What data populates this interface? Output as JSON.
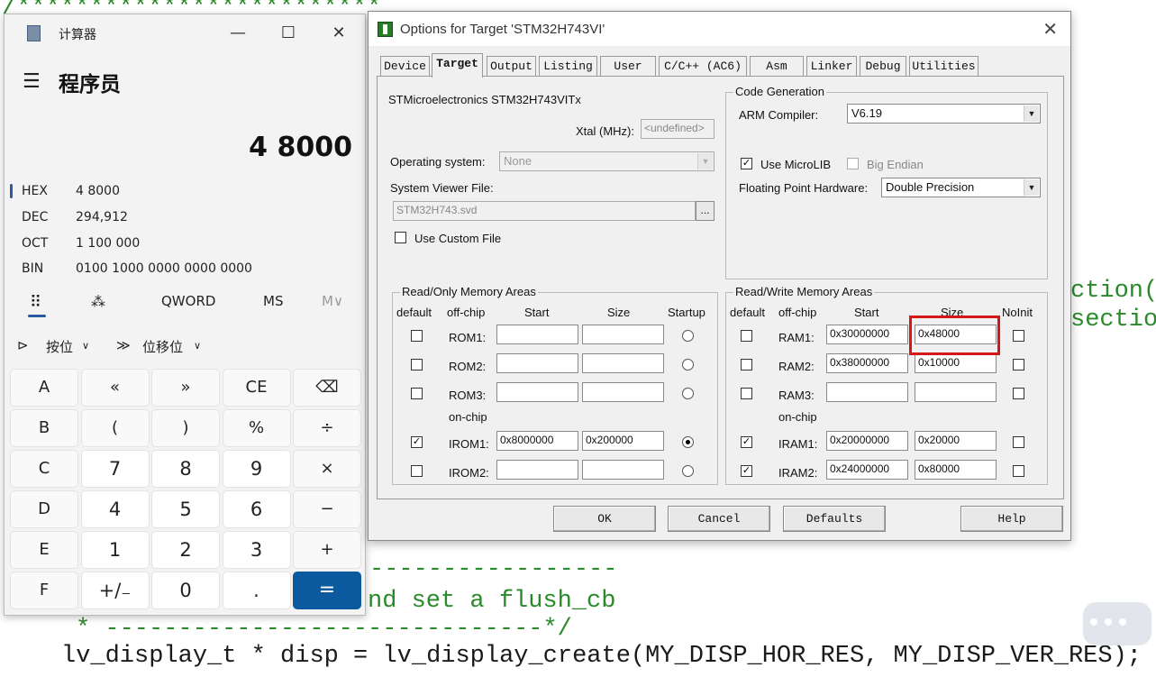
{
  "background_code": {
    "top_comment": "/*************************",
    "right_line1": "ction(",
    "right_line2": "sectio",
    "dash_line": "-----------------",
    "flush_line": "nd set a flush_cb",
    "comment_end": "* ------------------------------*/",
    "create_line": "lv_display_t * disp = lv_display_create(MY_DISP_HOR_RES, MY_DISP_VER_RES);",
    "partial_line": "  ..."
  },
  "calculator": {
    "title": "计算器",
    "mode": "程序员",
    "display": "4 8000",
    "radix": [
      {
        "label": "HEX",
        "value": "4 8000"
      },
      {
        "label": "DEC",
        "value": "294,912"
      },
      {
        "label": "OCT",
        "value": "1 100 000"
      },
      {
        "label": "BIN",
        "value": "0100 1000 0000 0000 0000"
      }
    ],
    "word_size": "QWORD",
    "ms": "MS",
    "mplus": "M∨",
    "bitwise": "按位",
    "bitshift": "位移位",
    "keys": [
      [
        "A",
        "«",
        "»",
        "CE",
        "⌫"
      ],
      [
        "B",
        "(",
        ")",
        "%",
        "÷"
      ],
      [
        "C",
        "7",
        "8",
        "9",
        "×"
      ],
      [
        "D",
        "4",
        "5",
        "6",
        "−"
      ],
      [
        "E",
        "1",
        "2",
        "3",
        "+"
      ],
      [
        "F",
        "+/₋",
        "0",
        ".",
        "="
      ]
    ]
  },
  "dialog": {
    "title": "Options for Target 'STM32H743VI'",
    "tabs": [
      "Device",
      "Target",
      "Output",
      "Listing",
      "User",
      "C/C++ (AC6)",
      "Asm",
      "Linker",
      "Debug",
      "Utilities"
    ],
    "active_tab": "Target",
    "device_name": "STMicroelectronics STM32H743VITx",
    "xtal_label": "Xtal (MHz):",
    "xtal_value": "<undefined>",
    "os_label": "Operating system:",
    "os_value": "None",
    "svf_label": "System Viewer File:",
    "svf_value": "STM32H743.svd",
    "browse": "...",
    "custom_file": "Use Custom File",
    "code_gen": {
      "legend": "Code Generation",
      "compiler_label": "ARM Compiler:",
      "compiler_value": "V6.19",
      "microlib": "Use MicroLIB",
      "microlib_checked": true,
      "big_endian": "Big Endian",
      "fpu_label": "Floating Point Hardware:",
      "fpu_value": "Double Precision"
    },
    "ro_group": {
      "legend": "Read/Only Memory Areas",
      "headers": [
        "default",
        "off-chip",
        "Start",
        "Size",
        "Startup"
      ],
      "on_chip": "on-chip",
      "rows": [
        {
          "name": "ROM1:",
          "default": false,
          "start": "",
          "size": "",
          "startup": false
        },
        {
          "name": "ROM2:",
          "default": false,
          "start": "",
          "size": "",
          "startup": false
        },
        {
          "name": "ROM3:",
          "default": false,
          "start": "",
          "size": "",
          "startup": false
        },
        {
          "name": "IROM1:",
          "default": true,
          "start": "0x8000000",
          "size": "0x200000",
          "startup": true
        },
        {
          "name": "IROM2:",
          "default": false,
          "start": "",
          "size": "",
          "startup": false
        }
      ]
    },
    "rw_group": {
      "legend": "Read/Write Memory Areas",
      "headers": [
        "default",
        "off-chip",
        "Start",
        "Size",
        "NoInit"
      ],
      "on_chip": "on-chip",
      "rows": [
        {
          "name": "RAM1:",
          "default": false,
          "start": "0x30000000",
          "size": "0x48000",
          "noinit": false
        },
        {
          "name": "RAM2:",
          "default": false,
          "start": "0x38000000",
          "size": "0x10000",
          "noinit": false
        },
        {
          "name": "RAM3:",
          "default": false,
          "start": "",
          "size": "",
          "noinit": false
        },
        {
          "name": "IRAM1:",
          "default": true,
          "start": "0x20000000",
          "size": "0x20000",
          "noinit": false
        },
        {
          "name": "IRAM2:",
          "default": true,
          "start": "0x24000000",
          "size": "0x80000",
          "noinit": false
        }
      ]
    },
    "buttons": {
      "ok": "OK",
      "cancel": "Cancel",
      "defaults": "Defaults",
      "help": "Help"
    }
  },
  "colors": {
    "highlight": "#d41818",
    "calc_accent": "#0b5aa0",
    "code_green": "#2a8a2a"
  }
}
